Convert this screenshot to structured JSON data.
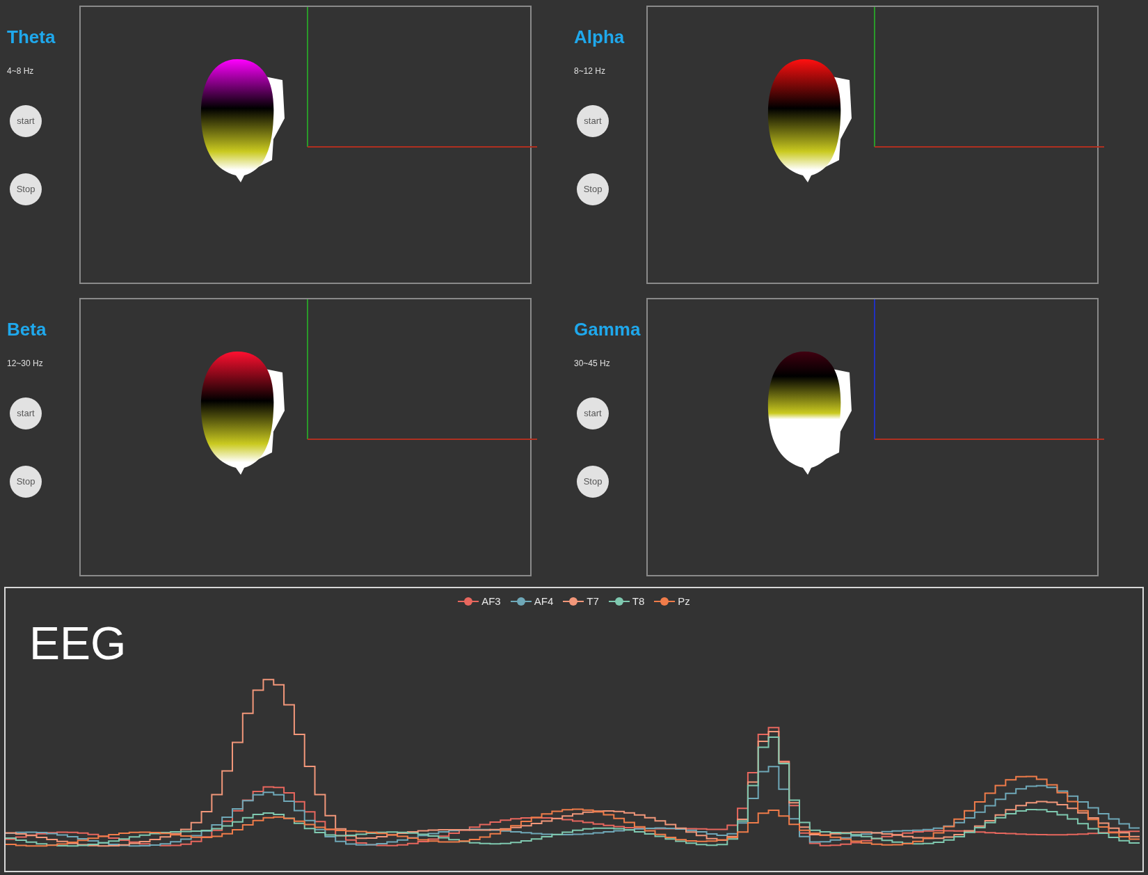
{
  "bands": [
    {
      "name": "Theta",
      "range": "4~8 Hz",
      "buttons": [
        "start",
        "Stop"
      ]
    },
    {
      "name": "Alpha",
      "range": "8~12 Hz",
      "buttons": [
        "start",
        "Stop"
      ]
    },
    {
      "name": "Beta",
      "range": "12~30 Hz",
      "buttons": [
        "start",
        "Stop"
      ]
    },
    {
      "name": "Gamma",
      "range": "30~45 Hz",
      "buttons": [
        "start",
        "Stop"
      ]
    }
  ],
  "eeg": {
    "title": "EEG",
    "legend": [
      {
        "label": "AF3",
        "color": "#e8675e"
      },
      {
        "label": "AF4",
        "color": "#6fa8b8"
      },
      {
        "label": "T7",
        "color": "#f2977a"
      },
      {
        "label": "T8",
        "color": "#7fc9b0"
      },
      {
        "label": "Pz",
        "color": "#f07c4a"
      }
    ]
  }
}
